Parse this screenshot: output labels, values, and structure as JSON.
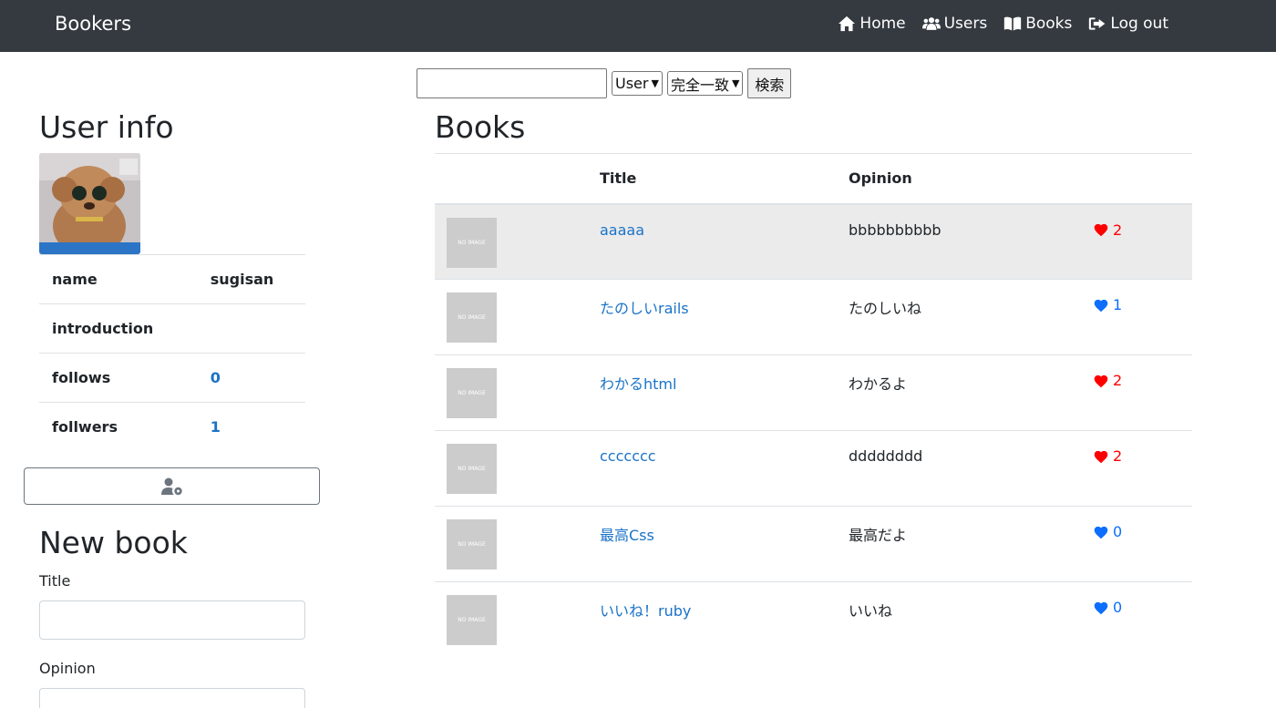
{
  "nav": {
    "brand": "Bookers",
    "links": [
      {
        "label": "Home",
        "icon": "home-icon"
      },
      {
        "label": "Users",
        "icon": "users-icon"
      },
      {
        "label": "Books",
        "icon": "book-icon"
      },
      {
        "label": "Log out",
        "icon": "sign-out-icon"
      }
    ]
  },
  "search": {
    "value": "",
    "model_selected": "User",
    "method_selected": "完全一致",
    "button": "検索"
  },
  "user_info": {
    "heading": "User info",
    "rows": [
      {
        "label": "name",
        "value": "sugisan"
      },
      {
        "label": "introduction",
        "value": ""
      },
      {
        "label": "follows",
        "value": "0"
      },
      {
        "label": "follwers",
        "value": "1"
      }
    ]
  },
  "new_book": {
    "heading": "New book",
    "title_label": "Title",
    "opinion_label": "Opinion"
  },
  "books": {
    "heading": "Books",
    "columns": [
      "",
      "Title",
      "Opinion",
      ""
    ],
    "no_image_text": "NO IMAGE",
    "rows": [
      {
        "title": "aaaaa",
        "opinion": "bbbbbbbbbb",
        "favorites": "2",
        "favorited": true
      },
      {
        "title": "たのしいrails",
        "opinion": "たのしいね",
        "favorites": "1",
        "favorited": false
      },
      {
        "title": "わかるhtml",
        "opinion": "わかるよ",
        "favorites": "2",
        "favorited": true
      },
      {
        "title": "ccccccc",
        "opinion": "dddddddd",
        "favorites": "2",
        "favorited": true
      },
      {
        "title": "最高Css",
        "opinion": "最高だよ",
        "favorites": "0",
        "favorited": false
      },
      {
        "title": "いいね！ruby",
        "opinion": "いいね",
        "favorites": "0",
        "favorited": false
      }
    ]
  },
  "colors": {
    "navbar": "#343a40",
    "link": "#1a73c8",
    "heart_red": "#ff0000",
    "heart_blue": "#0d6efd"
  }
}
